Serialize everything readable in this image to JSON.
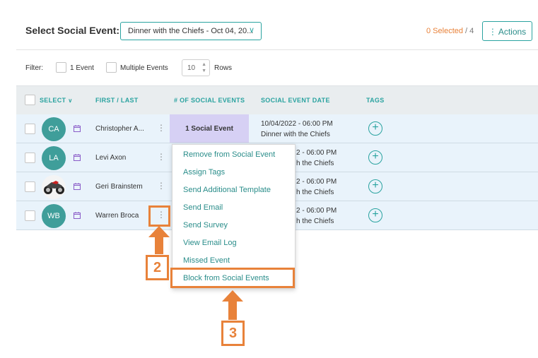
{
  "header": {
    "select_label": "Select Social Event:",
    "event_select_value": "Dinner with the Chiefs - Oct 04, 20...",
    "selected_count": "0 Selected",
    "total_count": "/ 4",
    "actions_label": "Actions"
  },
  "filter": {
    "label": "Filter:",
    "one_event": "1 Event",
    "multiple_events": "Multiple Events",
    "rows_value": "10",
    "rows_label": "Rows"
  },
  "table": {
    "columns": {
      "select": "SELECT",
      "first_last": "FIRST / LAST",
      "num_events": "# OF SOCIAL EVENTS",
      "event_date": "SOCIAL EVENT DATE",
      "tags": "TAGS"
    },
    "rows": [
      {
        "initials": "CA",
        "name": "Christopher A...",
        "events": "1 Social Event",
        "date": "10/04/2022 - 06:00 PM",
        "event": "Dinner with the Chiefs"
      },
      {
        "initials": "LA",
        "name": "Levi Axon",
        "events": "",
        "date": "2 - 06:00 PM",
        "event": "h the Chiefs"
      },
      {
        "initials": "",
        "name": "Geri Brainstem",
        "events": "",
        "date": "2 - 06:00 PM",
        "event": "h the Chiefs"
      },
      {
        "initials": "WB",
        "name": "Warren Broca",
        "events": "",
        "date": "2 - 06:00 PM",
        "event": "h the Chiefs"
      }
    ]
  },
  "context_menu": {
    "items": [
      "Remove from Social Event",
      "Assign Tags",
      "Send Additional Template",
      "Send Email",
      "Send Survey",
      "View Email Log",
      "Missed Event",
      "Block from Social Events"
    ]
  },
  "annotations": {
    "step_2": "2",
    "step_3": "3",
    "color": "#e8823a"
  },
  "colors": {
    "accent": "#2aa3a0",
    "avatar": "#3f9e9a",
    "row_bg": "#e9f3fb",
    "event_cell_bg": "#d6d0f4",
    "selected_count": "#e8823a"
  }
}
